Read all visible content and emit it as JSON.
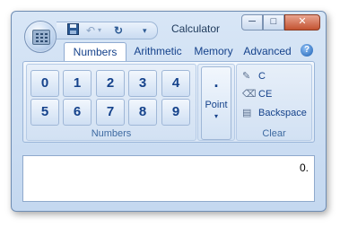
{
  "window": {
    "title": "Calculator"
  },
  "quick_access": {
    "save_icon": "save-icon",
    "undo_icon": "undo-icon",
    "redo_icon": "redo-icon",
    "customize_icon": "customize-arrow-icon"
  },
  "window_controls": {
    "minimize": "─",
    "maximize": "□",
    "close": "✕"
  },
  "tabs": [
    {
      "label": "Numbers",
      "active": true
    },
    {
      "label": "Arithmetic",
      "active": false
    },
    {
      "label": "Memory",
      "active": false
    },
    {
      "label": "Advanced",
      "active": false
    }
  ],
  "help": {
    "label": "?"
  },
  "numbers_group": {
    "label": "Numbers",
    "keys": [
      "0",
      "1",
      "2",
      "3",
      "4",
      "5",
      "6",
      "7",
      "8",
      "9"
    ]
  },
  "point_group": {
    "symbol": ".",
    "label": "Point",
    "arrow": "▾"
  },
  "clear_group": {
    "label": "Clear",
    "items": [
      {
        "label": "C",
        "icon": "clear-all-icon"
      },
      {
        "label": "CE",
        "icon": "eraser-icon"
      },
      {
        "label": "Backspace",
        "icon": "backspace-icon"
      }
    ]
  },
  "display": {
    "value": "0."
  },
  "colors": {
    "accent": "#15428b",
    "frame": "#c4d8f0"
  }
}
